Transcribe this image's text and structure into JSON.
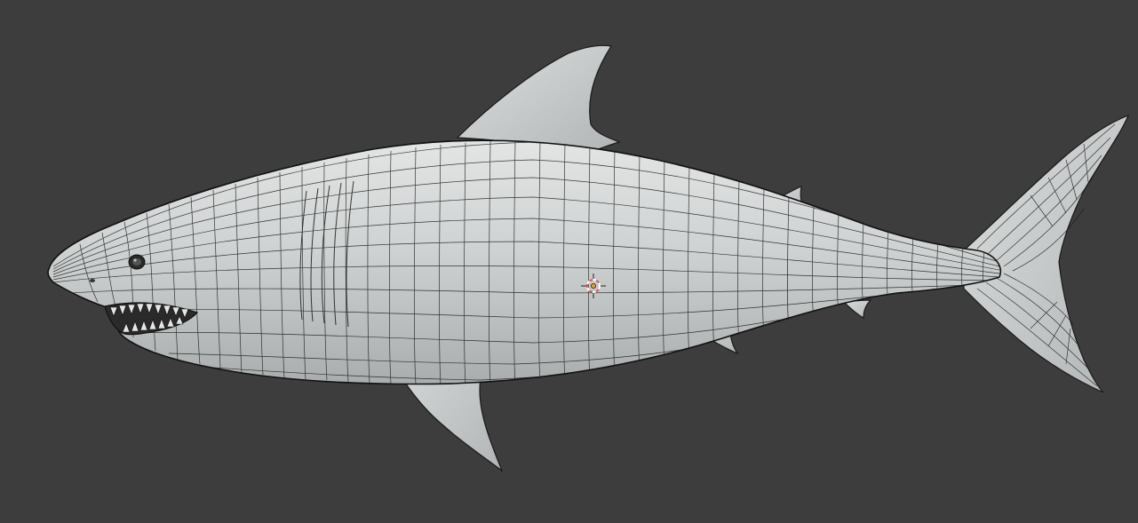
{
  "viewport": {
    "mode": "object-wireframe-overlay",
    "background_color": "#3d3d3d",
    "mesh_color": "#cfd1d1",
    "wire_color": "#1a1a1a",
    "cursor_colors": {
      "ring_a": "#e05555",
      "ring_b": "#ffffff",
      "cross": "#222222"
    }
  },
  "model": {
    "icon": "shark-mesh"
  },
  "cursor": {
    "icon": "3d-cursor-icon"
  },
  "origin": {
    "icon": "object-origin-icon",
    "color": "#f0a030"
  }
}
